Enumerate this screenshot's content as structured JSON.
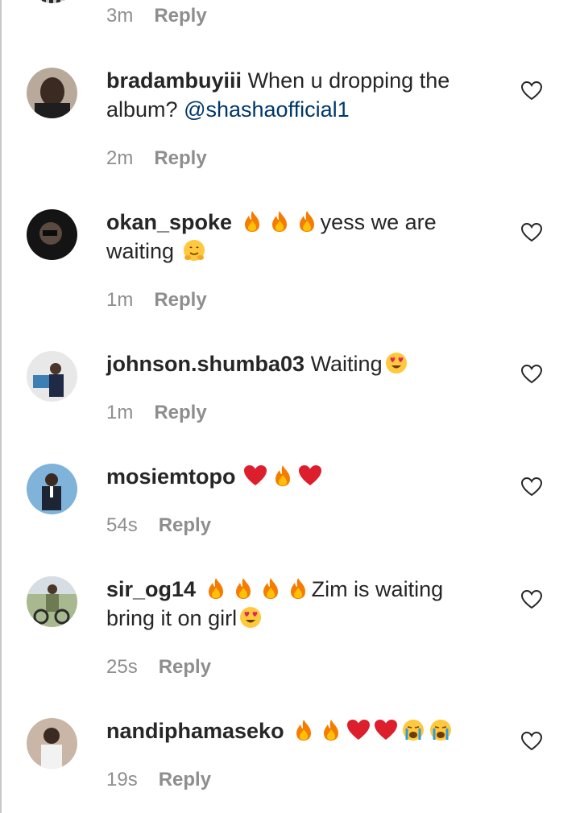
{
  "top": {
    "time": "3m",
    "reply_label": "Reply"
  },
  "comments": [
    {
      "username": "bradambuyiii",
      "text_before": "When u dropping the album?",
      "mention": "@shashaofficial1",
      "text_after": "",
      "time": "2m",
      "reply_label": "Reply",
      "emojis_inline": [],
      "emojis_end": []
    },
    {
      "username": "okan_spoke",
      "text_before": "yess we are waiting",
      "mention": "",
      "text_after": "",
      "time": "1m",
      "reply_label": "Reply",
      "emojis_inline": [
        "fire",
        "fire",
        "fire"
      ],
      "emojis_end": [
        "hugging-face"
      ]
    },
    {
      "username": "johnson.shumba03",
      "text_before": "Waiting",
      "mention": "",
      "text_after": "",
      "time": "1m",
      "reply_label": "Reply",
      "emojis_inline": [],
      "emojis_end": [
        "heart-eyes"
      ]
    },
    {
      "username": "mosiemtopo",
      "text_before": "",
      "mention": "",
      "text_after": "",
      "time": "54s",
      "reply_label": "Reply",
      "emojis_inline": [
        "red-heart",
        "fire",
        "red-heart"
      ],
      "emojis_end": []
    },
    {
      "username": "sir_og14",
      "text_before": "Zim is waiting bring it on girl",
      "mention": "",
      "text_after": "",
      "time": "25s",
      "reply_label": "Reply",
      "emojis_inline": [
        "fire",
        "fire",
        "fire",
        "fire"
      ],
      "emojis_end": [
        "heart-eyes"
      ]
    },
    {
      "username": "nandiphamaseko",
      "text_before": "",
      "mention": "",
      "text_after": "",
      "time": "19s",
      "reply_label": "Reply",
      "emojis_inline": [
        "fire",
        "fire",
        "red-heart",
        "red-heart",
        "crying-face",
        "crying-face"
      ],
      "emojis_end": []
    }
  ],
  "icons": {
    "like": "heart-outline-icon"
  },
  "colors": {
    "text": "#262626",
    "meta": "#8e8e8e",
    "mention": "#00376b",
    "heart_emoji": "#e0245e",
    "fire_emoji": "#f57c00"
  }
}
